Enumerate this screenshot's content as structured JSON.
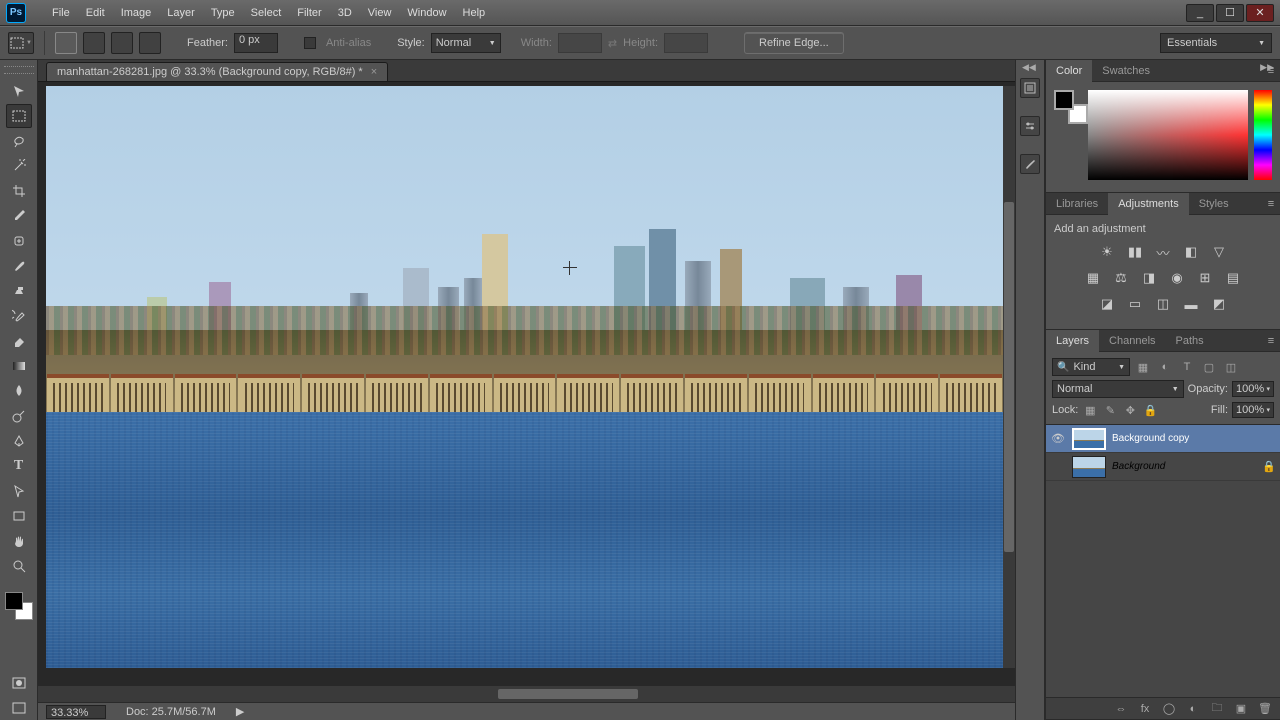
{
  "app": {
    "logo_text": "Ps"
  },
  "window_buttons": {
    "min": "_",
    "max": "☐",
    "close": "✕"
  },
  "menu": [
    "File",
    "Edit",
    "Image",
    "Layer",
    "Type",
    "Select",
    "Filter",
    "3D",
    "View",
    "Window",
    "Help"
  ],
  "options_bar": {
    "feather_label": "Feather:",
    "feather_value": "0 px",
    "antialias_label": "Anti-alias",
    "style_label": "Style:",
    "style_value": "Normal",
    "width_label": "Width:",
    "height_label": "Height:",
    "refine_label": "Refine Edge...",
    "workspace": "Essentials"
  },
  "document": {
    "tab_title": "manhattan-268281.jpg @ 33.3% (Background copy, RGB/8#) *"
  },
  "status": {
    "zoom": "33.33%",
    "doc_size": "Doc: 25.7M/56.7M"
  },
  "panels": {
    "color": {
      "tab_color": "Color",
      "tab_swatches": "Swatches"
    },
    "adjustments": {
      "tab_lib": "Libraries",
      "tab_adj": "Adjustments",
      "tab_styles": "Styles",
      "title": "Add an adjustment"
    },
    "layers": {
      "tab_layers": "Layers",
      "tab_channels": "Channels",
      "tab_paths": "Paths",
      "kind": "Kind",
      "blend": "Normal",
      "opacity_label": "Opacity:",
      "opacity_value": "100%",
      "lock_label": "Lock:",
      "fill_label": "Fill:",
      "fill_value": "100%",
      "items": [
        {
          "name": "Background copy",
          "visible": true,
          "locked": false,
          "selected": true
        },
        {
          "name": "Background",
          "visible": false,
          "locked": true,
          "selected": false
        }
      ]
    }
  }
}
